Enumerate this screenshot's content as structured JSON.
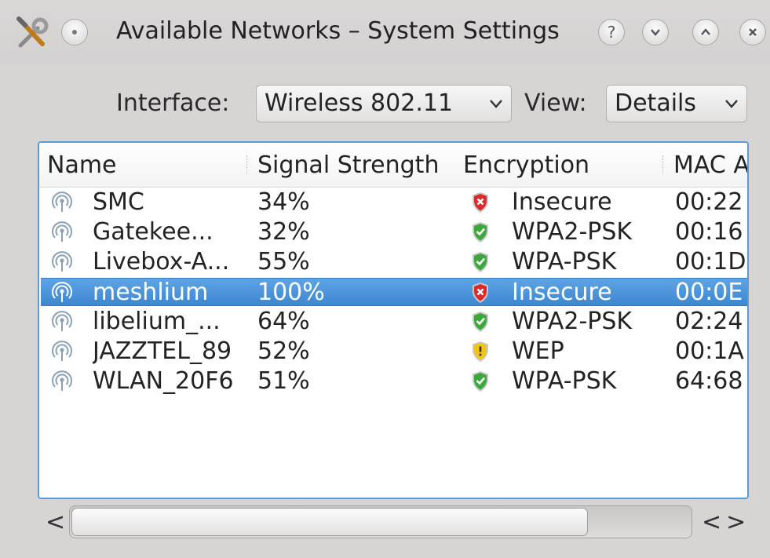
{
  "window": {
    "title": "Available Networks – System Settings",
    "app_icon": "tools-icon",
    "buttons": {
      "help": "?",
      "minimize_icon": "chevron-down-icon",
      "maximize_icon": "chevron-up-icon",
      "close_icon": "close-icon"
    }
  },
  "toolbar": {
    "interface_label": "Interface:",
    "interface_value": "Wireless 802.11",
    "view_label": "View:",
    "view_value": "Details"
  },
  "table": {
    "columns": [
      "Name",
      "Signal Strength",
      "Encryption",
      "MAC Address"
    ],
    "selected_index": 3,
    "rows": [
      {
        "name": "SMC",
        "signal": "34%",
        "encryption": "Insecure",
        "security": "insecure",
        "mac": "00:22"
      },
      {
        "name": "Gatekee...",
        "signal": "32%",
        "encryption": "WPA2-PSK",
        "security": "secure",
        "mac": "00:16"
      },
      {
        "name": "Livebox-A...",
        "signal": "55%",
        "encryption": "WPA-PSK",
        "security": "secure",
        "mac": "00:1D"
      },
      {
        "name": "meshlium",
        "signal": "100%",
        "encryption": "Insecure",
        "security": "insecure",
        "mac": "00:0E"
      },
      {
        "name": "libelium_...",
        "signal": "64%",
        "encryption": "WPA2-PSK",
        "security": "secure",
        "mac": "02:24"
      },
      {
        "name": "JAZZTEL_89",
        "signal": "52%",
        "encryption": "WEP",
        "security": "weak",
        "mac": "00:1A"
      },
      {
        "name": "WLAN_20F6",
        "signal": "51%",
        "encryption": "WPA-PSK",
        "security": "secure",
        "mac": "64:68"
      }
    ]
  },
  "scrollbar": {
    "left_arrow": "<",
    "right_arrows": "<>",
    "visible_fraction": 0.83
  },
  "colors": {
    "selection": "#4a93da",
    "focus_border": "#5c9bd5",
    "shield_insecure": "#d92b2b",
    "shield_secure": "#3aa83a",
    "shield_weak": "#f2c418"
  }
}
